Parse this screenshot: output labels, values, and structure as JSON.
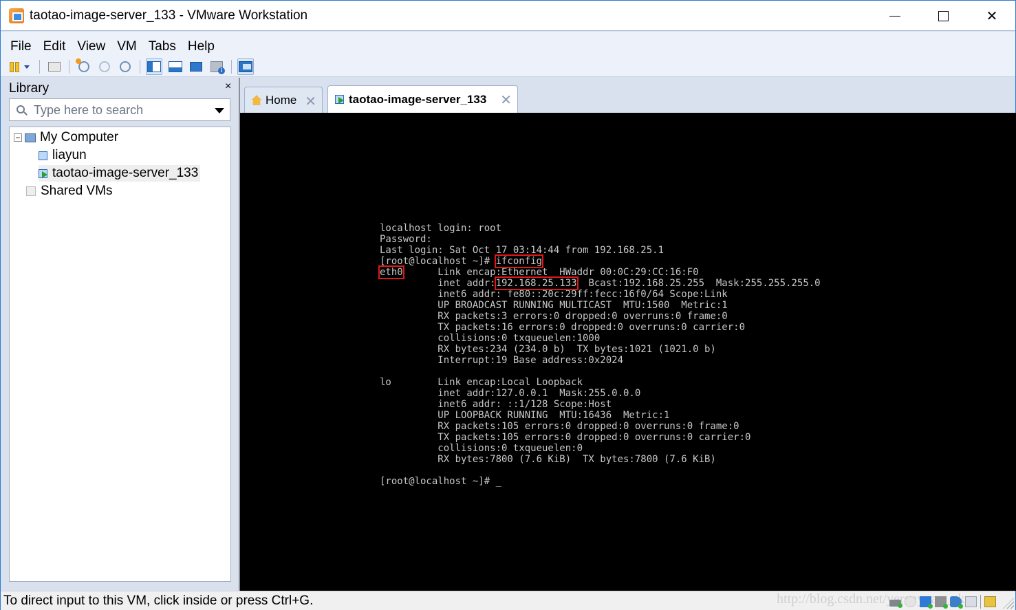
{
  "window": {
    "title": "taotao-image-server_133 - VMware Workstation",
    "controls": {
      "minimize": "minimize",
      "maximize": "maximize",
      "close": "close"
    }
  },
  "menu": [
    "File",
    "Edit",
    "View",
    "VM",
    "Tabs",
    "Help"
  ],
  "toolbar": {
    "buttons": [
      {
        "name": "power-pause",
        "icon": "pause-icon"
      },
      {
        "name": "power-dropdown",
        "icon": "chevron-down-icon"
      },
      {
        "name": "send-ctrl-alt-del",
        "icon": "network-keys-icon"
      },
      {
        "name": "take-snapshot",
        "icon": "snapshot-take-icon"
      },
      {
        "name": "revert-snapshot",
        "icon": "snapshot-revert-icon"
      },
      {
        "name": "snapshot-manager",
        "icon": "snapshot-manager-icon"
      },
      {
        "name": "show-library",
        "icon": "library-panel-icon",
        "active": true
      },
      {
        "name": "show-thumbnail-bar",
        "icon": "thumbnail-bar-icon"
      },
      {
        "name": "full-screen",
        "icon": "fullscreen-icon"
      },
      {
        "name": "unity",
        "icon": "unity-icon"
      },
      {
        "name": "console-view",
        "icon": "console-view-icon",
        "active": true
      }
    ]
  },
  "library": {
    "title": "Library",
    "close": "×",
    "search_placeholder": "Type here to search",
    "tree": [
      {
        "label": "My Computer",
        "level": 0,
        "icon": "computer-icon",
        "expanded": true
      },
      {
        "label": "liayun",
        "level": 1,
        "icon": "vm-icon"
      },
      {
        "label": "taotao-image-server_133",
        "level": 1,
        "icon": "vm-running-icon",
        "selected": true
      },
      {
        "label": "Shared VMs",
        "level": 0,
        "icon": "shared-vms-icon"
      }
    ]
  },
  "tabs": [
    {
      "label": "Home",
      "icon": "home-icon",
      "active": false,
      "close": "✕"
    },
    {
      "label": "taotao-image-server_133",
      "icon": "vm-running-icon",
      "active": true,
      "close": "✕"
    }
  ],
  "console": {
    "lines": [
      "localhost login: root",
      "Password:",
      "Last login: Sat Oct 17 03:14:44 from 192.168.25.1",
      "[root@localhost ~]# ifconfig",
      "eth0      Link encap:Ethernet  HWaddr 00:0C:29:CC:16:F0",
      "          inet addr:192.168.25.133  Bcast:192.168.25.255  Mask:255.255.255.0",
      "          inet6 addr: fe80::20c:29ff:fecc:16f0/64 Scope:Link",
      "          UP BROADCAST RUNNING MULTICAST  MTU:1500  Metric:1",
      "          RX packets:3 errors:0 dropped:0 overruns:0 frame:0",
      "          TX packets:16 errors:0 dropped:0 overruns:0 carrier:0",
      "          collisions:0 txqueuelen:1000",
      "          RX bytes:234 (234.0 b)  TX bytes:1021 (1021.0 b)",
      "          Interrupt:19 Base address:0x2024",
      "",
      "lo        Link encap:Local Loopback",
      "          inet addr:127.0.0.1  Mask:255.0.0.0",
      "          inet6 addr: ::1/128 Scope:Host",
      "          UP LOOPBACK RUNNING  MTU:16436  Metric:1",
      "          RX packets:105 errors:0 dropped:0 overruns:0 frame:0",
      "          TX packets:105 errors:0 dropped:0 overruns:0 carrier:0",
      "          collisions:0 txqueuelen:0",
      "          RX bytes:7800 (7.6 KiB)  TX bytes:7800 (7.6 KiB)",
      "",
      "[root@localhost ~]# _"
    ],
    "highlights": [
      {
        "line": 3,
        "text": "ifconfig"
      },
      {
        "line": 4,
        "text": "eth0"
      },
      {
        "line": 5,
        "text": "192.168.25.133"
      }
    ],
    "highlight_color": "#e01818"
  },
  "status": {
    "text": "To direct input to this VM, click inside or press Ctrl+G.",
    "watermark": "http://blog.csdn.net/yerenyuan_pku",
    "devices": [
      {
        "name": "hard-disk",
        "icon": "hard-disk-icon",
        "active": true
      },
      {
        "name": "cd-dvd",
        "icon": "cd-icon",
        "active": false
      },
      {
        "name": "network-adapter",
        "icon": "network-adapter-icon",
        "active": true
      },
      {
        "name": "printer",
        "icon": "printer-icon",
        "active": true
      },
      {
        "name": "sound-card",
        "icon": "sound-icon",
        "active": true
      },
      {
        "name": "display",
        "icon": "display-icon",
        "active": false
      },
      {
        "name": "message-log",
        "icon": "message-log-icon",
        "active": false
      }
    ]
  }
}
